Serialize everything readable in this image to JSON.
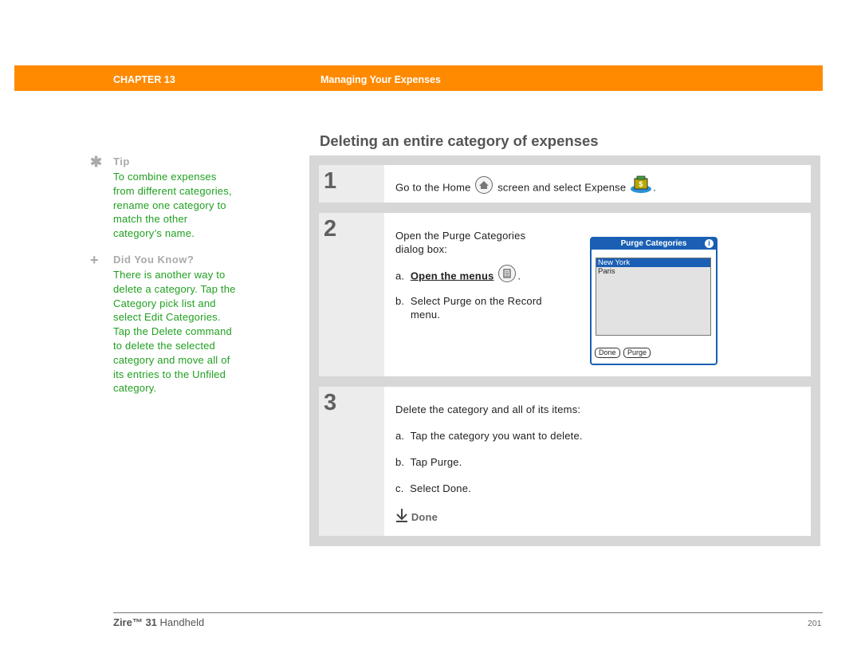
{
  "header": {
    "chapter": "CHAPTER 13",
    "title": "Managing Your Expenses",
    "color": "#ff8a00"
  },
  "sidebar": {
    "tip": {
      "icon": "asterisk-icon",
      "heading": "Tip",
      "lines": [
        "To combine expenses",
        "from different categories,",
        "rename one category to",
        "match the other",
        "category’s name."
      ]
    },
    "did_you_know": {
      "icon": "plus-icon",
      "heading": "Did You Know?",
      "lines": [
        "There is another way to",
        "delete a category. Tap the",
        "Category pick list and",
        "select Edit Categories.",
        "Tap the Delete command",
        "to delete the selected",
        "category and move all of",
        "its entries to the Unfiled",
        "category."
      ]
    }
  },
  "section_title": "Deleting an entire category of expenses",
  "steps": [
    {
      "number": "1",
      "text_before": "Go to the Home",
      "text_middle": "screen and select Expense",
      "text_after": "."
    },
    {
      "number": "2",
      "intro_line1": "Open the Purge Categories",
      "intro_line2": "dialog box:",
      "a_prefix": "a.",
      "a_link": "Open the menus",
      "a_after": ".",
      "b_prefix": "b.",
      "b_line1": "Select Purge on the Record",
      "b_line2": "menu."
    },
    {
      "number": "3",
      "intro": "Delete the category and all of its items:",
      "items": [
        {
          "prefix": "a.",
          "text": "Tap the category you want to delete."
        },
        {
          "prefix": "b.",
          "text": "Tap Purge."
        },
        {
          "prefix": "c.",
          "text": "Select Done."
        }
      ],
      "done_label": "Done"
    }
  ],
  "dialog": {
    "title": "Purge Categories",
    "info_glyph": "i",
    "items": [
      {
        "label": "New York",
        "selected": true
      },
      {
        "label": "Paris",
        "selected": false
      }
    ],
    "buttons": [
      "Done",
      "Purge"
    ],
    "accent": "#1a5fb4"
  },
  "footer": {
    "product_bold": "Zire™ 31",
    "product_rest": " Handheld",
    "page": "201"
  }
}
